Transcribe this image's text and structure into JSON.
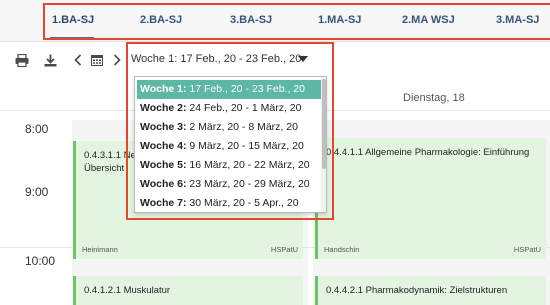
{
  "tabs": [
    {
      "label": "1.BA-SJ",
      "active": true
    },
    {
      "label": "2.BA-SJ",
      "active": false
    },
    {
      "label": "3.BA-SJ",
      "active": false
    },
    {
      "label": "1.MA-SJ",
      "active": false
    },
    {
      "label": "2.MA WSJ",
      "active": false
    },
    {
      "label": "3.MA-SJ",
      "active": false
    }
  ],
  "toolbar": {
    "print_icon": "printer-icon",
    "download_icon": "download-icon",
    "prev_icon": "chevron-left-icon",
    "calendar_icon": "calendar-icon",
    "next_icon": "chevron-right-icon",
    "week_prefix": "Woche 1:",
    "week_range": " 17 Feb., 20 - 23 Feb., 20"
  },
  "week_options": [
    {
      "week": "Woche 1:",
      "range": " 17 Feb., 20 - 23 Feb., 20",
      "selected": true
    },
    {
      "week": "Woche 2:",
      "range": " 24 Feb., 20 - 1 März, 20",
      "selected": false
    },
    {
      "week": "Woche 3:",
      "range": " 2 März, 20 - 8 März, 20",
      "selected": false
    },
    {
      "week": "Woche 4:",
      "range": " 9 März, 20 - 15 März, 20",
      "selected": false
    },
    {
      "week": "Woche 5:",
      "range": " 16 März, 20 - 22 März, 20",
      "selected": false
    },
    {
      "week": "Woche 6:",
      "range": " 23 März, 20 - 29 März, 20",
      "selected": false
    },
    {
      "week": "Woche 7:",
      "range": " 30 März, 20 - 5 Apr., 20",
      "selected": false
    }
  ],
  "calendar": {
    "day_header": "Dienstag, 18",
    "times": [
      "8:00",
      "9:00",
      "10:00"
    ],
    "events": [
      {
        "title": "0.4.3.1.1 Ne",
        "subtitle": "Übersicht",
        "person": "Heinimann",
        "room": "HSPatU"
      },
      {
        "title": "0.4.4.1.1 Allgemeine Pharmakologie: Einführung",
        "subtitle": "",
        "person": "Handschin",
        "room": "HSPatU"
      },
      {
        "title": "0.4.1.2.1 Muskulatur",
        "subtitle": "",
        "person": "",
        "room": ""
      },
      {
        "title": "0.4.4.2.1 Pharmakodynamik: Zielstrukturen",
        "subtitle": "",
        "person": "",
        "room": ""
      }
    ]
  },
  "colors": {
    "highlight": "#e4462f",
    "selected_option": "#5cb8a4",
    "event_bg": "#e3f4e1",
    "event_border": "#70c16a",
    "tab_text": "#36557a"
  }
}
